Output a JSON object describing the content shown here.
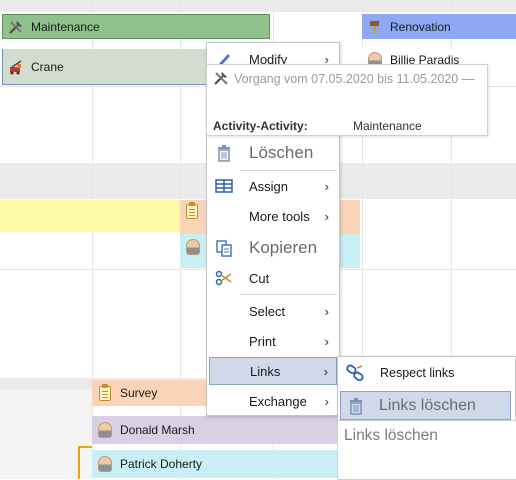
{
  "gantt": {
    "bars": {
      "maintenance": "Maintenance",
      "crane": "Crane",
      "renovation": "Renovation",
      "billie": "Billie Paradis",
      "survey": "Survey",
      "donald": "Donald Marsh",
      "patrick": "Patrick Doherty"
    }
  },
  "tooltip": {
    "title": "Vorgang vom 07.05.2020 bis 11.05.2020 —",
    "field_label": "Activity-Activity:",
    "field_value": "Maintenance"
  },
  "context_menu": {
    "items": [
      {
        "label": "Modify",
        "has_submenu": true,
        "icon": "pencil-icon"
      },
      {
        "label": "Löschen",
        "has_submenu": false,
        "icon": "trash-icon"
      },
      {
        "label": "Assign",
        "has_submenu": true,
        "icon": "table-icon"
      },
      {
        "label": "More tools",
        "has_submenu": true,
        "icon": ""
      },
      {
        "label": "Kopieren",
        "has_submenu": false,
        "icon": "copy-icon"
      },
      {
        "label": "Cut",
        "has_submenu": false,
        "icon": "scissors-icon"
      },
      {
        "label": "Select",
        "has_submenu": true,
        "icon": ""
      },
      {
        "label": "Print",
        "has_submenu": true,
        "icon": ""
      },
      {
        "label": "Links",
        "has_submenu": true,
        "icon": ""
      },
      {
        "label": "Exchange",
        "has_submenu": true,
        "icon": ""
      }
    ],
    "submenu_arrow": "›"
  },
  "links_submenu": {
    "items": [
      {
        "label": "Respect links",
        "icon": "link-icon"
      },
      {
        "label": "Links löschen",
        "icon": "trash-icon"
      }
    ],
    "tooltip": "Links löschen"
  },
  "colors": {
    "maintenance": "#8fc18c",
    "crane": "#d3dccf",
    "renovation": "#8fa8f4",
    "survey": "#fbd3b9",
    "donald": "#d9d0e4",
    "patrick": "#c9eef4",
    "yellow_row": "#fdfaa7",
    "menu_highlight": "#cfd9ea"
  }
}
